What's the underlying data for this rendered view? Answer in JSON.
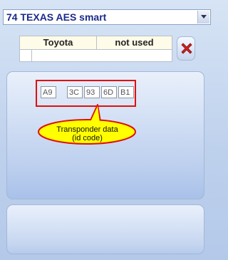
{
  "dropdown": {
    "selected": "74 TEXAS AES smart"
  },
  "table": {
    "make": "Toyota",
    "status": "not used"
  },
  "transponder": {
    "bytes": [
      "A9",
      "3C",
      "93",
      "6D",
      "B1"
    ]
  },
  "callout": {
    "line1": "Transponder data",
    "line2": "(id code)"
  },
  "icons": {
    "dropdown_arrow": "chevron-down-icon",
    "delete": "delete-x-icon"
  },
  "colors": {
    "highlight_border": "#e01010",
    "callout_fill": "#ffff00",
    "title_text": "#1b2a8a"
  }
}
